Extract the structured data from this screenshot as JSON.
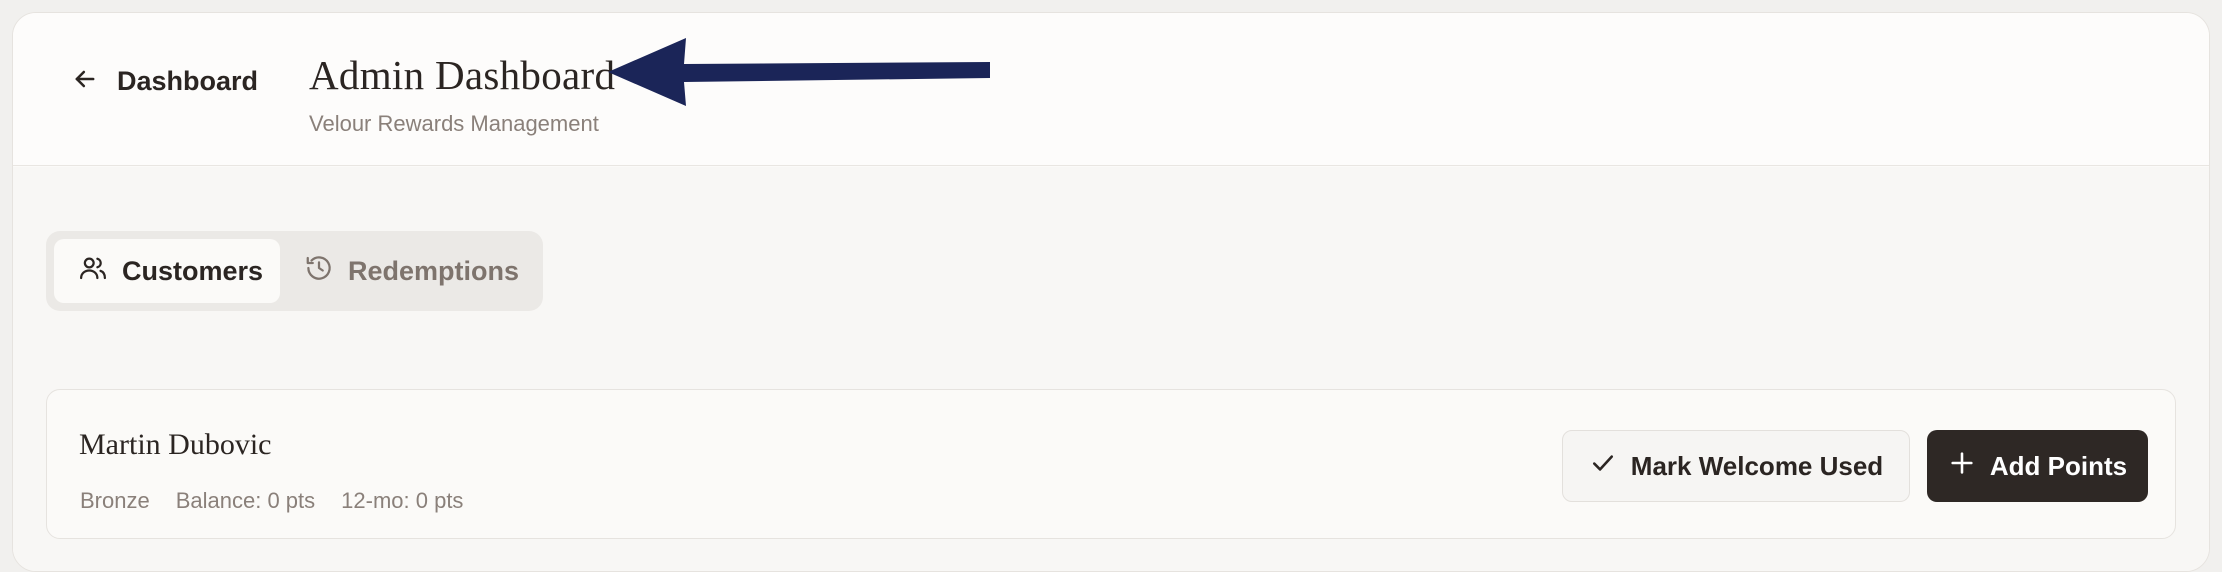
{
  "header": {
    "back_label": "Dashboard",
    "title": "Admin Dashboard",
    "subtitle": "Velour Rewards Management"
  },
  "tabs": [
    {
      "label": "Customers",
      "icon": "users-icon",
      "active": true
    },
    {
      "label": "Redemptions",
      "icon": "history-icon",
      "active": false
    }
  ],
  "customer": {
    "name": "Martin Dubovic",
    "tier": "Bronze",
    "balance": "Balance: 0 pts",
    "twelve_month": "12-mo: 0 pts"
  },
  "actions": {
    "mark_welcome_label": "Mark Welcome Used",
    "add_points_label": "Add Points"
  },
  "colors": {
    "primary_dark": "#2e2825",
    "arrow": "#1b2558",
    "muted_text": "#8a807a"
  }
}
